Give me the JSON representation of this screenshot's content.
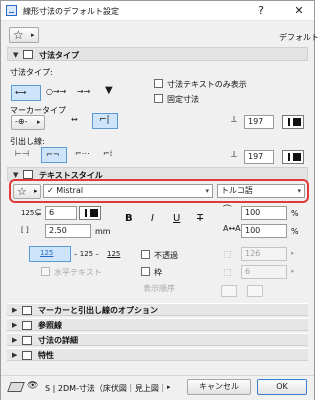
{
  "window": {
    "title": "線形寸法のデフォルト設定",
    "help": "?",
    "close": "✕"
  },
  "toolbar": {
    "favorites_icon": "star-icon",
    "default_label": "デフォルト"
  },
  "dim_type": {
    "header": "寸法タイプ",
    "dim_type_label": "寸法タイプ:",
    "marker_type_label": "マーカータイプ",
    "witness_label": "引出し線:",
    "text_only_label": "寸法テキストのみ表示",
    "fixed_dim_label": "固定寸法",
    "pen1_value": "197",
    "pen2_value": "197"
  },
  "text_style": {
    "header": "テキストスタイル",
    "font_value": "Mistral",
    "script_value": "トルコ語",
    "size_value": "6",
    "spacing_value": "2.50",
    "spacing_unit": "mm",
    "width_pct": "100",
    "spacing_pct": "100",
    "pct_unit": "%",
    "bold": "B",
    "italic": "I",
    "underline": "U",
    "strike": "T",
    "align_center_label": "125",
    "align_sample_a": "125",
    "align_sample_b": "125",
    "opaque_label": "不透過",
    "frame_label": "枠",
    "horizontal_text_label": "水平テキスト",
    "display_order_label": "表示順序",
    "bg_pen_value": "126",
    "frame_pen_value": "6"
  },
  "sections": [
    {
      "label": "マーカーと引出し線のオプション"
    },
    {
      "label": "参照線"
    },
    {
      "label": "寸法の詳細"
    },
    {
      "label": "特性"
    }
  ],
  "footer": {
    "layer_text": "S | 2DM-寸法（床伏図｜見上図｜...",
    "cancel_label": "キャンセル",
    "ok_label": "OK"
  }
}
